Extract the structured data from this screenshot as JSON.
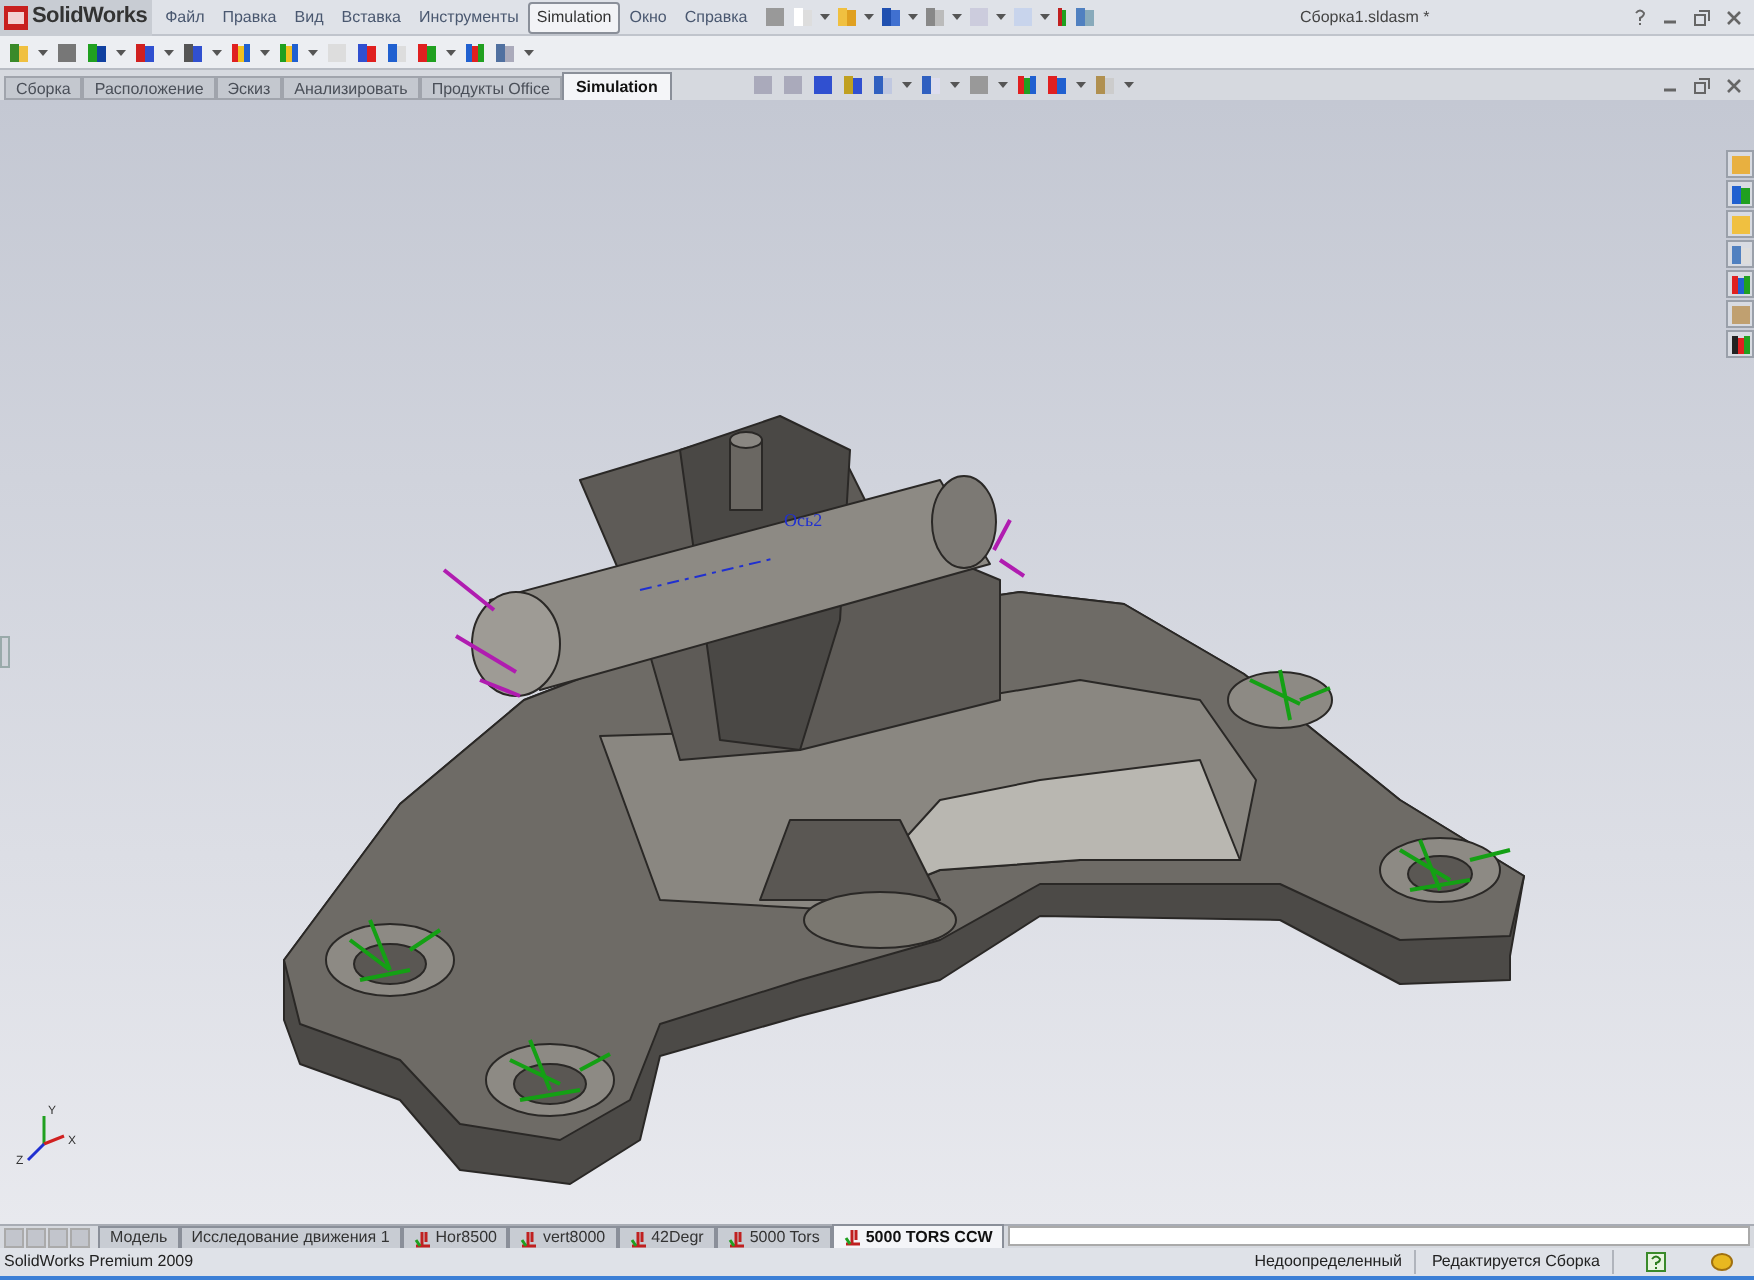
{
  "window": {
    "app_name": "SolidWorks",
    "title": "Сборка1.sldasm *"
  },
  "menu": [
    {
      "label": "Файл",
      "selected": false
    },
    {
      "label": "Правка",
      "selected": false
    },
    {
      "label": "Вид",
      "selected": false
    },
    {
      "label": "Вставка",
      "selected": false
    },
    {
      "label": "Инструменты",
      "selected": false
    },
    {
      "label": "Simulation",
      "selected": true
    },
    {
      "label": "Окно",
      "selected": false
    },
    {
      "label": "Справка",
      "selected": false
    }
  ],
  "command_tabs": [
    {
      "label": "Сборка",
      "selected": false
    },
    {
      "label": "Расположение",
      "selected": false
    },
    {
      "label": "Эскиз",
      "selected": false
    },
    {
      "label": "Анализировать",
      "selected": false
    },
    {
      "label": "Продукты Office",
      "selected": false
    },
    {
      "label": "Simulation",
      "selected": true
    }
  ],
  "viewport": {
    "axis_label": "Ось2",
    "triad_labels": [
      "Y",
      "X",
      "Z"
    ]
  },
  "bottom_tabs": [
    {
      "label": "Модель",
      "kind": "model",
      "selected": false
    },
    {
      "label": "Исследование движения 1",
      "kind": "motion",
      "selected": false
    },
    {
      "label": "Hor8500",
      "kind": "study",
      "selected": false
    },
    {
      "label": "vert8000",
      "kind": "study",
      "selected": false
    },
    {
      "label": "42Degr",
      "kind": "study",
      "selected": false
    },
    {
      "label": "5000 Tors",
      "kind": "study",
      "selected": false
    },
    {
      "label": "5000 TORS CCW",
      "kind": "study",
      "selected": true
    }
  ],
  "status_bar": {
    "product": "SolidWorks Premium 2009",
    "fields": [
      "Недоопределенный",
      "Редактируется Сборка"
    ]
  }
}
